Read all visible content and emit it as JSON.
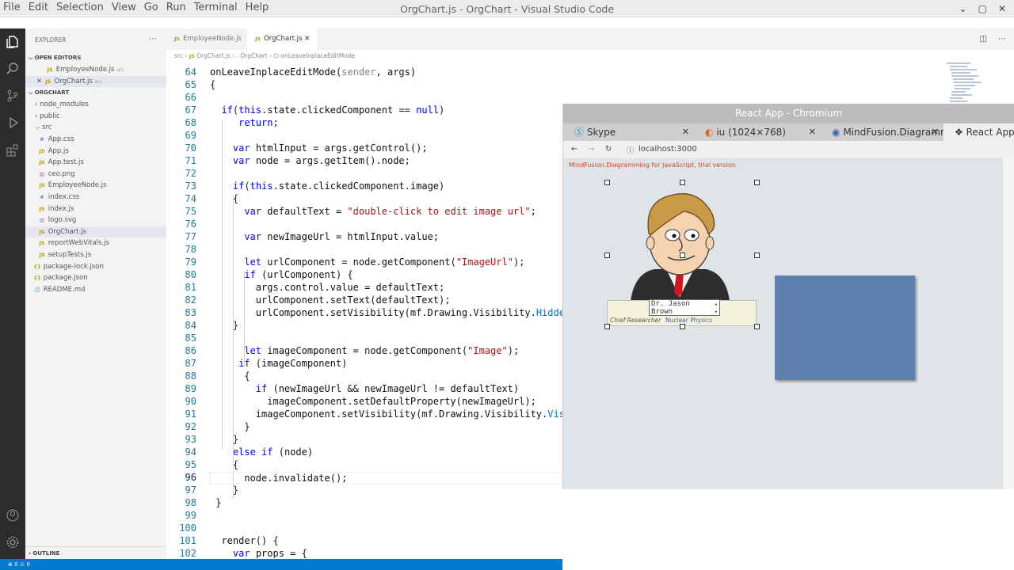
{
  "window": {
    "title": "OrgChart.js - OrgChart - Visual Studio Code"
  },
  "menu": [
    "File",
    "Edit",
    "Selection",
    "View",
    "Go",
    "Run",
    "Terminal",
    "Help"
  ],
  "sidebar": {
    "header": "EXPLORER",
    "open_editors_label": "OPEN EDITORS",
    "open_editors": [
      {
        "name": "EmployeeNode.js",
        "folder": "src"
      },
      {
        "name": "OrgChart.js",
        "folder": "src"
      }
    ],
    "project_label": "ORGCHART",
    "tree": [
      {
        "name": "node_modules",
        "kind": "folder-closed"
      },
      {
        "name": "public",
        "kind": "folder-closed"
      },
      {
        "name": "src",
        "kind": "folder-open"
      },
      {
        "name": "App.css",
        "kind": "css"
      },
      {
        "name": "App.js",
        "kind": "js"
      },
      {
        "name": "App.test.js",
        "kind": "js"
      },
      {
        "name": "ceo.png",
        "kind": "img"
      },
      {
        "name": "EmployeeNode.js",
        "kind": "js"
      },
      {
        "name": "index.css",
        "kind": "css"
      },
      {
        "name": "index.js",
        "kind": "js"
      },
      {
        "name": "logo.svg",
        "kind": "img"
      },
      {
        "name": "OrgChart.js",
        "kind": "js"
      },
      {
        "name": "reportWebVitals.js",
        "kind": "js"
      },
      {
        "name": "setupTests.js",
        "kind": "js"
      },
      {
        "name": "package-lock.json",
        "kind": "json"
      },
      {
        "name": "package.json",
        "kind": "json"
      },
      {
        "name": "README.md",
        "kind": "md"
      }
    ],
    "outline_label": "OUTLINE"
  },
  "tabs": [
    {
      "label": "EmployeeNode.js",
      "active": false
    },
    {
      "label": "OrgChart.js",
      "active": true
    }
  ],
  "breadcrumb": [
    "src",
    "OrgChart.js",
    "OrgChart",
    "onLeaveInplaceEditMode"
  ],
  "code": {
    "current_line": 96,
    "lines": [
      {
        "n": 64,
        "t": "onLeaveInplaceEditMode(sender, args)"
      },
      {
        "n": 65,
        "t": "{"
      },
      {
        "n": 66,
        "t": ""
      },
      {
        "n": 67,
        "t": "  if(this.state.clickedComponent == null)"
      },
      {
        "n": 68,
        "t": "     return;"
      },
      {
        "n": 69,
        "t": ""
      },
      {
        "n": 70,
        "t": "    var htmlInput = args.getControl();"
      },
      {
        "n": 71,
        "t": "    var node = args.getItem().node;"
      },
      {
        "n": 72,
        "t": ""
      },
      {
        "n": 73,
        "t": "    if(this.state.clickedComponent.image)"
      },
      {
        "n": 74,
        "t": "    {"
      },
      {
        "n": 75,
        "t": "      var defaultText = \"double-click to edit image url\";"
      },
      {
        "n": 76,
        "t": ""
      },
      {
        "n": 77,
        "t": "      var newImageUrl = htmlInput.value;"
      },
      {
        "n": 78,
        "t": ""
      },
      {
        "n": 79,
        "t": "      let urlComponent = node.getComponent(\"ImageUrl\");"
      },
      {
        "n": 80,
        "t": "      if (urlComponent) {"
      },
      {
        "n": 81,
        "t": "        args.control.value = defaultText;"
      },
      {
        "n": 82,
        "t": "        urlComponent.setText(defaultText);"
      },
      {
        "n": 83,
        "t": "        urlComponent.setVisibility(mf.Drawing.Visibility.Hidden"
      },
      {
        "n": 84,
        "t": "    }"
      },
      {
        "n": 85,
        "t": ""
      },
      {
        "n": 86,
        "t": "      let imageComponent = node.getComponent(\"Image\");"
      },
      {
        "n": 87,
        "t": "     if (imageComponent)"
      },
      {
        "n": 88,
        "t": "      {"
      },
      {
        "n": 89,
        "t": "        if (newImageUrl && newImageUrl != defaultText)"
      },
      {
        "n": 90,
        "t": "          imageComponent.setDefaultProperty(newImageUrl);"
      },
      {
        "n": 91,
        "t": "        imageComponent.setVisibility(mf.Drawing.Visibility.Visible"
      },
      {
        "n": 92,
        "t": "      }"
      },
      {
        "n": 93,
        "t": "    }"
      },
      {
        "n": 94,
        "t": "    else if (node)"
      },
      {
        "n": 95,
        "t": "    {"
      },
      {
        "n": 96,
        "t": "      node.invalidate();"
      },
      {
        "n": 97,
        "t": "    }"
      },
      {
        "n": 98,
        "t": " }"
      },
      {
        "n": 99,
        "t": ""
      },
      {
        "n": 100,
        "t": ""
      },
      {
        "n": 101,
        "t": "  render() {"
      },
      {
        "n": 102,
        "t": "    var props = {"
      }
    ]
  },
  "chromium": {
    "title": "React App - Chromium",
    "tabs": [
      {
        "label": "Skype",
        "active": false
      },
      {
        "label": "iu (1024×768)",
        "active": false
      },
      {
        "label": "MindFusion.Diagramm",
        "active": false
      },
      {
        "label": "React App",
        "active": true
      }
    ],
    "url": "localhost:3000",
    "trial_notice": "MindFusion.Diagramming for JavaScript, trial version",
    "node": {
      "name_edit_value": "Dr. Jason\nBrown",
      "role": "Chief Researcher",
      "department": "Nuclear Physics"
    }
  },
  "statusbar": {
    "errors": "0",
    "warnings": "0"
  },
  "colors": {
    "keyword": "#0000ff",
    "string": "#a31515",
    "param": "#808080",
    "accent": "#007acc",
    "node_fill": "#6080b0"
  }
}
